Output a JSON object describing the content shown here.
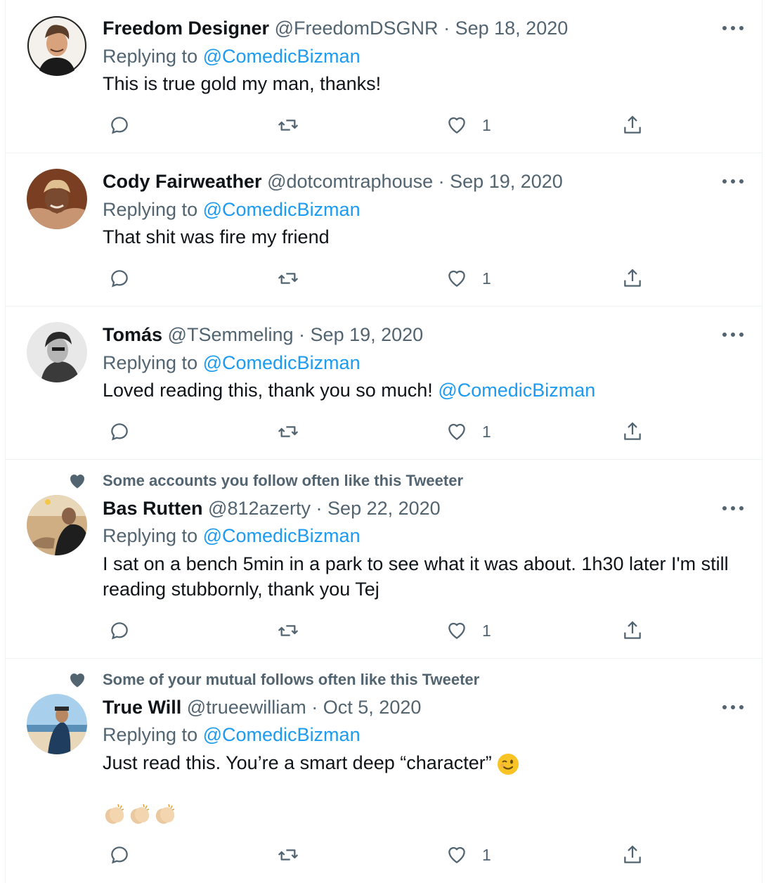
{
  "replying_label": "Replying to",
  "tweets": [
    {
      "name": "Freedom Designer",
      "handle": "@FreedomDSGNR",
      "sep": "·",
      "date": "Sep 18, 2020",
      "replying_to": "@ComedicBizman",
      "text": "This is true gold my man, thanks!",
      "likes": "1",
      "avatar_colors": [
        "#f2efe9",
        "#3b2a20",
        "#d7a27c"
      ]
    },
    {
      "name": "Cody Fairweather",
      "handle": "@dotcomtraphouse",
      "sep": "·",
      "date": "Sep 19, 2020",
      "replying_to": "@ComedicBizman",
      "text": "That shit was fire my friend",
      "likes": "1",
      "avatar_colors": [
        "#8a4a2a",
        "#5a2c1a",
        "#c99a6c"
      ]
    },
    {
      "name": "Tomás",
      "handle": "@TSemmeling",
      "sep": "·",
      "date": "Sep 19, 2020",
      "replying_to": "@ComedicBizman",
      "text": "Loved reading this, thank you so much!",
      "text_mention": "@ComedicBizman",
      "likes": "1",
      "avatar_colors": [
        "#d9d9d9",
        "#3a3a3a",
        "#9a9a9a"
      ]
    },
    {
      "social_context": "Some accounts you follow often like this Tweeter",
      "name": "Bas Rutten",
      "handle": "@812azerty",
      "sep": "·",
      "date": "Sep 22, 2020",
      "replying_to": "@ComedicBizman",
      "text_line1": "I sat on a bench 5min in a park to see what it was about. 1h30 later I'm still",
      "text_line2": "reading stubbornly, thank you Tej",
      "likes": "1",
      "avatar_colors": [
        "#c7a27a",
        "#2a2a2a",
        "#8a7560"
      ]
    },
    {
      "social_context": "Some of your mutual follows often like this Tweeter",
      "name": "True Will",
      "handle": "@trueewilliam",
      "sep": "·",
      "date": "Oct 5, 2020",
      "replying_to": "@ComedicBizman",
      "text": "Just read this. You’re a smart deep “character”",
      "likes": "1",
      "avatar_colors": [
        "#9cc7e6",
        "#1f3d5e",
        "#e8d7b8"
      ]
    }
  ],
  "icons": [
    "reply-icon",
    "retweet-icon",
    "like-icon",
    "share-icon",
    "more-icon",
    "social-heart-icon",
    "wink-emoji",
    "clapping-hands-emoji"
  ],
  "accent_color": "#1d9bf0",
  "muted_color": "#536471"
}
